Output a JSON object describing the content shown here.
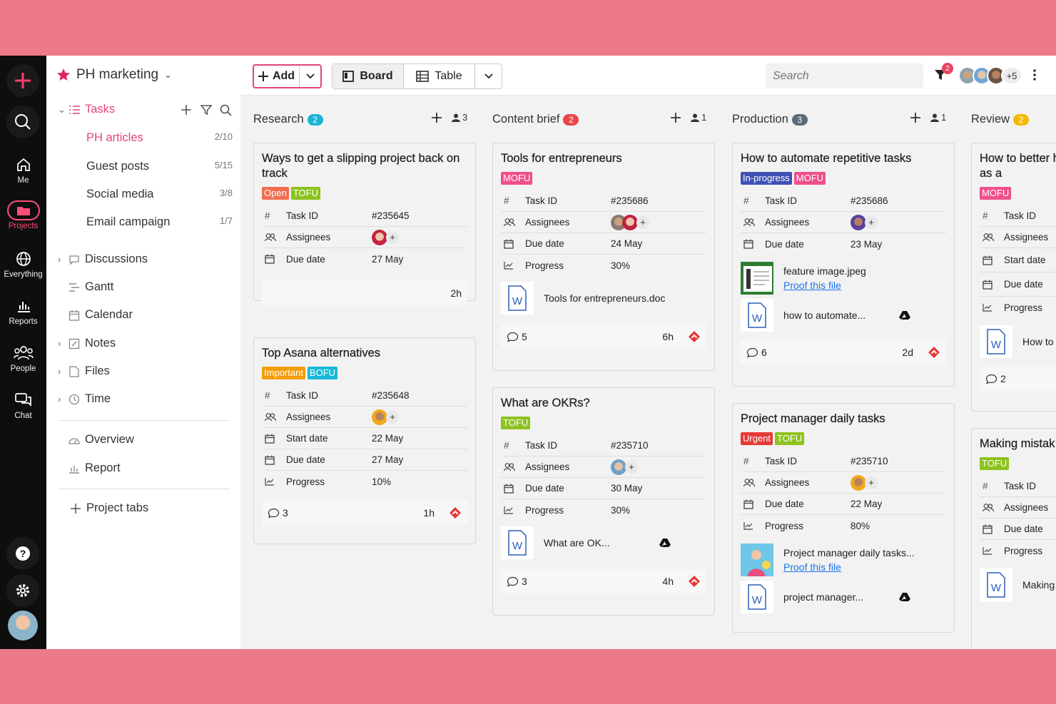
{
  "rail": {
    "me": "Me",
    "projects": "Projects",
    "everything": "Everything",
    "reports": "Reports",
    "people": "People",
    "chat": "Chat"
  },
  "sidebar": {
    "project_name": "PH marketing",
    "tasks": "Tasks",
    "subitems": [
      {
        "label": "PH articles",
        "count": "2/10"
      },
      {
        "label": "Guest posts",
        "count": "5/15"
      },
      {
        "label": "Social media",
        "count": "3/8"
      },
      {
        "label": "Email campaign",
        "count": "1/7"
      }
    ],
    "items": [
      "Discussions",
      "Gantt",
      "Calendar",
      "Notes",
      "Files",
      "Time"
    ],
    "extras": [
      "Overview",
      "Report"
    ],
    "project_tabs": "Project tabs"
  },
  "toolbar": {
    "add": "Add",
    "board": "Board",
    "table": "Table",
    "search_placeholder": "Search",
    "filter_count": "2",
    "more_members": "+5"
  },
  "columns": [
    {
      "name": "Research",
      "count": "2",
      "color": "#18b4d6",
      "assignees": "3"
    },
    {
      "name": "Content brief",
      "count": "2",
      "color": "#e94545",
      "assignees": "1"
    },
    {
      "name": "Production",
      "count": "3",
      "color": "#5b6b7a",
      "assignees": "1"
    },
    {
      "name": "Review",
      "count": "2",
      "color": "#f5b800"
    }
  ],
  "labels": {
    "task_id": "Task ID",
    "assignees": "Assignees",
    "due_date": "Due date",
    "start_date": "Start date",
    "progress": "Progress",
    "proof": "Proof this file"
  },
  "cards": {
    "c1": {
      "title": "Ways to get a slipping project back on track",
      "tags": [
        "Open",
        "TOFU"
      ],
      "task_id": "#235645",
      "due": "27 May",
      "time": "2h"
    },
    "c2": {
      "title": "Top Asana alternatives",
      "tags": [
        "Important",
        "BOFU"
      ],
      "task_id": "#235648",
      "start": "22 May",
      "due": "27 May",
      "progress": "10%",
      "comments": "3",
      "time": "1h"
    },
    "c3": {
      "title": "Tools for entrepreneurs",
      "tags": [
        "MOFU"
      ],
      "task_id": "#235686",
      "due": "24 May",
      "progress": "30%",
      "file": "Tools for entrepreneurs.doc",
      "comments": "5",
      "time": "6h"
    },
    "c4": {
      "title": "What are OKRs?",
      "tags": [
        "TOFU"
      ],
      "task_id": "#235710",
      "due": "30 May",
      "progress": "30%",
      "file": "What are OK...",
      "comments": "3",
      "time": "4h"
    },
    "c5": {
      "title": "How to automate repetitive tasks",
      "tags": [
        "In-progress",
        "MOFU"
      ],
      "task_id": "#235686",
      "due": "23 May",
      "file1": "feature image.jpeg",
      "file2": "how to automate...",
      "comments": "6",
      "time": "2d"
    },
    "c6": {
      "title": "Project manager daily tasks",
      "tags": [
        "Urgent",
        "TOFU"
      ],
      "task_id": "#235710",
      "due": "22 May",
      "progress": "80%",
      "file1": "Project manager daily tasks...",
      "file2": "project manager..."
    },
    "c7": {
      "title": "How to better h deadlines as a",
      "tags": [
        "MOFU"
      ],
      "file": "How to",
      "comments": "2"
    },
    "c8": {
      "title": "Making mistak",
      "tags": [
        "TOFU"
      ],
      "file": "Making"
    }
  },
  "colors": {
    "accent": "#e0457a",
    "Open": "#f26d4f",
    "TOFU": "#8dc21f",
    "MOFU": "#ef4f8b",
    "BOFU": "#19b8d8",
    "Important": "#f59e0b",
    "In-progress": "#3f51b5",
    "Urgent": "#e53935"
  }
}
